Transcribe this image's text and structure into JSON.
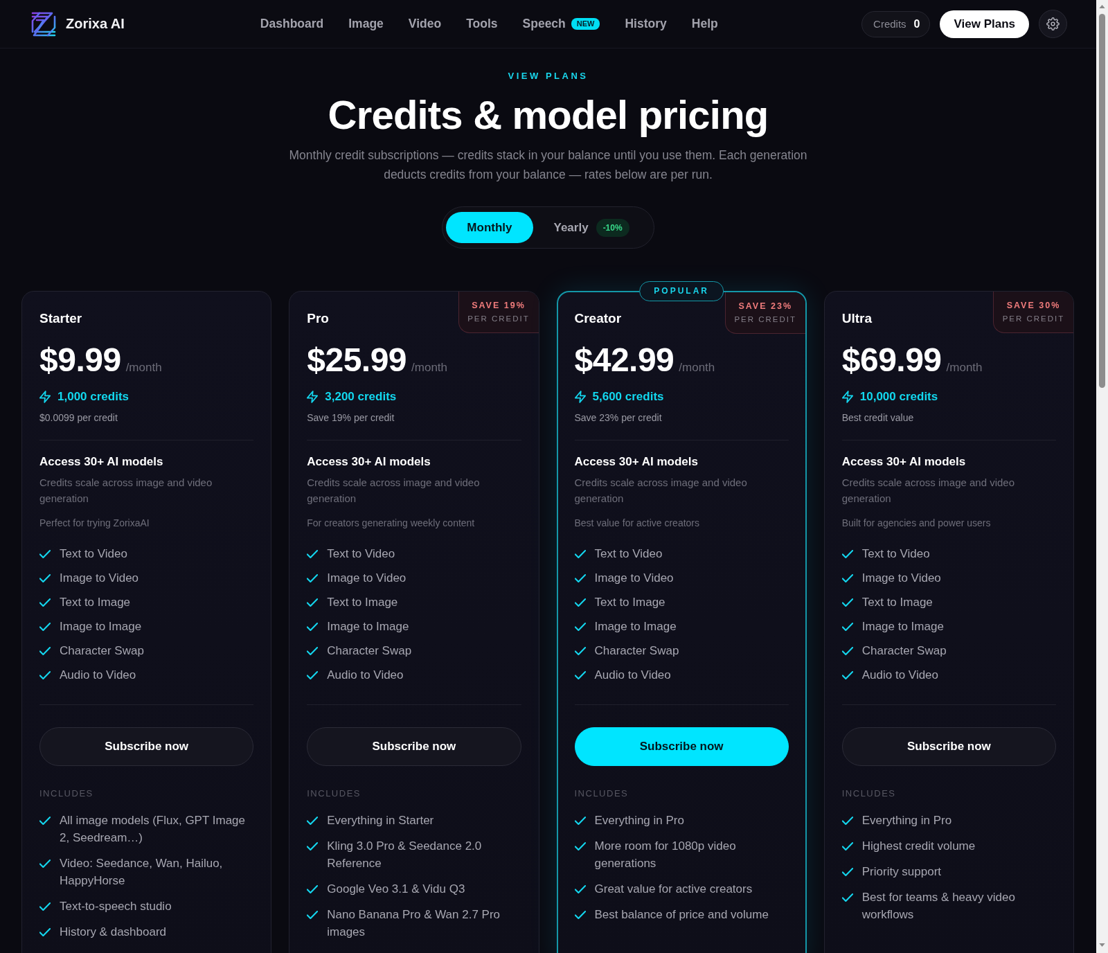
{
  "nav": {
    "brand": "Zorixa AI",
    "links": [
      {
        "label": "Dashboard"
      },
      {
        "label": "Image"
      },
      {
        "label": "Video"
      },
      {
        "label": "Tools"
      },
      {
        "label": "Speech",
        "badge": "NEW"
      },
      {
        "label": "History"
      },
      {
        "label": "Help"
      }
    ],
    "credits": {
      "label": "Credits",
      "value": "0"
    },
    "cta": "View Plans"
  },
  "header": {
    "eyebrow": "VIEW PLANS",
    "title": "Credits & model pricing",
    "subtitle": "Monthly credit subscriptions — credits stack in your balance until you use them. Each generation deducts credits from your balance — rates below are per run."
  },
  "billing_toggle": {
    "options": [
      {
        "label": "Monthly",
        "selected": true
      },
      {
        "label": "Yearly",
        "selected": false,
        "badge": "-10%"
      }
    ]
  },
  "plans": [
    {
      "name": "Starter",
      "price": "$9.99",
      "period": "/month",
      "credits": "1,000 credits",
      "credit_note": "$0.0099 per credit",
      "featured": false,
      "models_title": "Access 30+ AI models",
      "models_description": "Credits scale across image and video generation",
      "tagline": "Perfect for trying ZorixaAI",
      "features": [
        "Text to Video",
        "Image to Video",
        "Text to Image",
        "Image to Image",
        "Character Swap",
        "Audio to Video"
      ],
      "button": "Subscribe now",
      "includes_label": "INCLUDES",
      "includes": [
        "All image models (Flux, GPT Image 2, Seedream…)",
        "Video: Seedance, Wan, Hailuo, HappyHorse",
        "Text-to-speech studio",
        "History & dashboard"
      ]
    },
    {
      "name": "Pro",
      "price": "$25.99",
      "period": "/month",
      "credits": "3,200 credits",
      "credit_note": "Save 19% per credit",
      "save": {
        "title": "SAVE 19%",
        "subtitle": "PER CREDIT"
      },
      "featured": false,
      "models_title": "Access 30+ AI models",
      "models_description": "Credits scale across image and video generation",
      "tagline": "For creators generating weekly content",
      "features": [
        "Text to Video",
        "Image to Video",
        "Text to Image",
        "Image to Image",
        "Character Swap",
        "Audio to Video"
      ],
      "button": "Subscribe now",
      "includes_label": "INCLUDES",
      "includes": [
        "Everything in Starter",
        "Kling 3.0 Pro & Seedance 2.0 Reference",
        "Google Veo 3.1 & Vidu Q3",
        "Nano Banana Pro & Wan 2.7 Pro images"
      ]
    },
    {
      "name": "Creator",
      "price": "$42.99",
      "period": "/month",
      "credits": "5,600 credits",
      "credit_note": "Save 23% per credit",
      "save": {
        "title": "SAVE 23%",
        "subtitle": "PER CREDIT"
      },
      "featured": true,
      "ribbon": "POPULAR",
      "models_title": "Access 30+ AI models",
      "models_description": "Credits scale across image and video generation",
      "tagline": "Best value for active creators",
      "features": [
        "Text to Video",
        "Image to Video",
        "Text to Image",
        "Image to Image",
        "Character Swap",
        "Audio to Video"
      ],
      "button": "Subscribe now",
      "includes_label": "INCLUDES",
      "includes": [
        "Everything in Pro",
        "More room for 1080p video generations",
        "Great value for active creators",
        "Best balance of price and volume"
      ]
    },
    {
      "name": "Ultra",
      "price": "$69.99",
      "period": "/month",
      "credits": "10,000 credits",
      "credit_note": "Best credit value",
      "save": {
        "title": "SAVE 30%",
        "subtitle": "PER CREDIT"
      },
      "featured": false,
      "models_title": "Access 30+ AI models",
      "models_description": "Credits scale across image and video generation",
      "tagline": "Built for agencies and power users",
      "features": [
        "Text to Video",
        "Image to Video",
        "Text to Image",
        "Image to Image",
        "Character Swap",
        "Audio to Video"
      ],
      "button": "Subscribe now",
      "includes_label": "INCLUDES",
      "includes": [
        "Everything in Pro",
        "Highest credit volume",
        "Priority support",
        "Best for teams & heavy video workflows"
      ]
    }
  ]
}
